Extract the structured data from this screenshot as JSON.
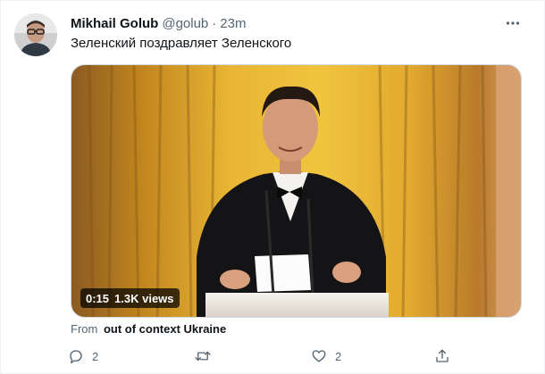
{
  "tweet": {
    "author_name": "Mikhail Golub",
    "handle": "@golub",
    "separator": "·",
    "time": "23m",
    "text": "Зеленский поздравляет Зеленского"
  },
  "media": {
    "duration": "0:15",
    "views": "1.3K views",
    "source_prefix": "From",
    "source_name": "out of context Ukraine"
  },
  "actions": {
    "reply_count": "2",
    "retweet_count": "",
    "like_count": "2"
  },
  "icons": {
    "more": "more-icon",
    "reply": "reply-icon",
    "retweet": "retweet-icon",
    "like": "like-icon",
    "share": "share-icon"
  },
  "colors": {
    "text_primary": "#0f1419",
    "text_secondary": "#536471",
    "border": "#cfd9de"
  }
}
